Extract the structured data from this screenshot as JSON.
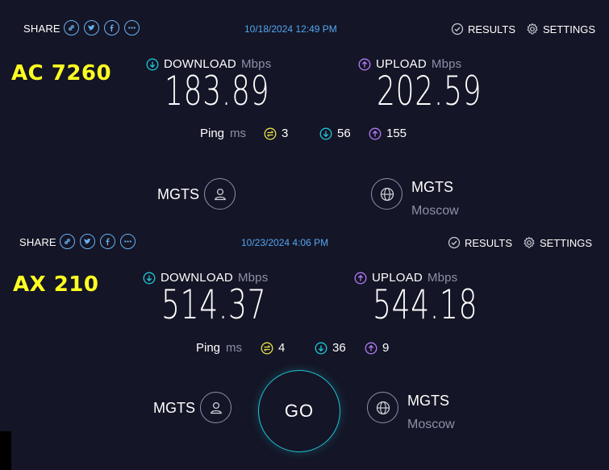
{
  "results": [
    {
      "share_label": "SHARE",
      "date": "10/18/2024 12:49 PM",
      "results_label": "RESULTS",
      "settings_label": "SETTINGS",
      "device": "AC 7260",
      "download_label": "DOWNLOAD",
      "download_unit": "Mbps",
      "download_value": "183.89",
      "upload_label": "UPLOAD",
      "upload_unit": "Mbps",
      "upload_value": "202.59",
      "ping_label": "Ping",
      "ping_unit": "ms",
      "ping_idle": "3",
      "ping_download": "56",
      "ping_upload": "155",
      "isp": "MGTS",
      "server_name": "MGTS",
      "server_location": "Moscow"
    },
    {
      "share_label": "SHARE",
      "date": "10/23/2024 4:06 PM",
      "results_label": "RESULTS",
      "settings_label": "SETTINGS",
      "device": "AX 210",
      "download_label": "DOWNLOAD",
      "download_unit": "Mbps",
      "download_value": "514.37",
      "upload_label": "UPLOAD",
      "upload_unit": "Mbps",
      "upload_value": "544.18",
      "ping_label": "Ping",
      "ping_unit": "ms",
      "ping_idle": "4",
      "ping_download": "36",
      "ping_upload": "9",
      "isp": "MGTS",
      "server_name": "MGTS",
      "server_location": "Moscow",
      "go_label": "GO"
    }
  ],
  "colors": {
    "background": "#141526",
    "accent_blue": "#55a6f0",
    "download": "#1ec6d6",
    "upload": "#b17bf5",
    "ping_idle": "#e6e24a",
    "device_label": "#ffff22",
    "muted": "#8d90a8"
  },
  "icons": [
    "link-icon",
    "twitter-icon",
    "facebook-icon",
    "more-icon",
    "check-circle-icon",
    "gear-icon",
    "download-arrow-icon",
    "upload-arrow-icon",
    "ping-idle-icon",
    "user-icon",
    "globe-icon"
  ]
}
